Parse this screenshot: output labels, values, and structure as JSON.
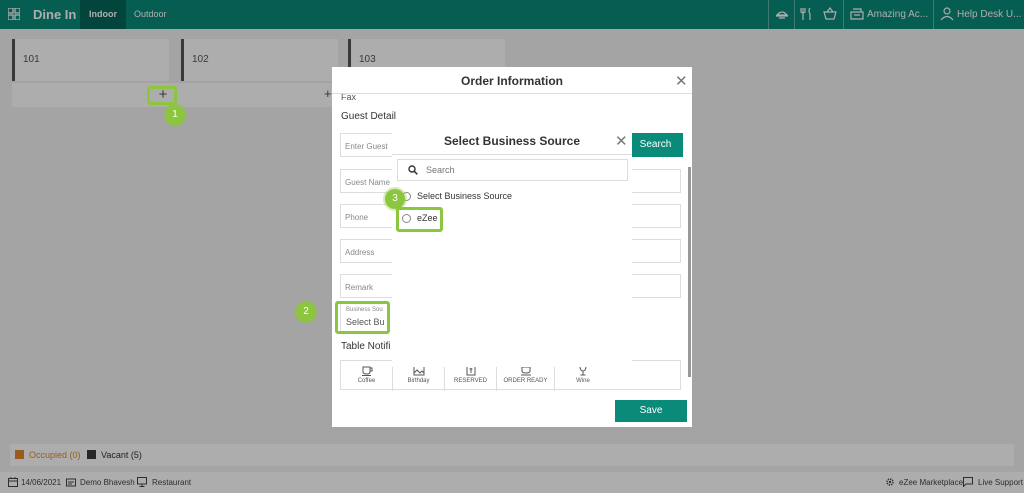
{
  "topbar": {
    "title": "Dine In",
    "tabs": [
      "Indoor",
      "Outdoor"
    ],
    "property_label": "Amazing Ac...",
    "user_label": "Help Desk U..."
  },
  "floor": {
    "tables": [
      "101",
      "102",
      "103"
    ],
    "add_symbol": "+"
  },
  "legend": {
    "occupied": "Occupied (0)",
    "vacant": "Vacant (5)",
    "colors": {
      "occupied": "#e0882a",
      "vacant": "#3a3a3a"
    }
  },
  "footer": {
    "date": "14/06/2021",
    "user": "Demo Bhavesh",
    "outlet": "Restaurant",
    "marketplace": "eZee Marketplace",
    "support": "Live Support"
  },
  "order_dialog": {
    "title": "Order Information",
    "fax_label": "Fax",
    "guest_detail": "Guest Detail",
    "enter_guest_placeholder": "Enter Guest",
    "search_button": "Search",
    "guest_name_placeholder": "Guest Name",
    "phone_placeholder": "Phone",
    "address_placeholder": "Address",
    "remark_placeholder": "Remark",
    "business_source_label": "Business Sou",
    "business_source_value": "Select Bu",
    "table_notification": "Table Notifi",
    "notifications": [
      "Coffee",
      "Birthday",
      "RESERVED",
      "ORDER READY",
      "Wine"
    ],
    "save_button": "Save"
  },
  "bs_dialog": {
    "title": "Select Business Source",
    "search_placeholder": "Search",
    "options": [
      "Select Business Source",
      "eZee"
    ]
  },
  "callouts": [
    "1",
    "2",
    "3"
  ],
  "colors": {
    "brand": "#0a8a78",
    "brand_dark": "#04665a",
    "highlight": "#8cc63f"
  }
}
